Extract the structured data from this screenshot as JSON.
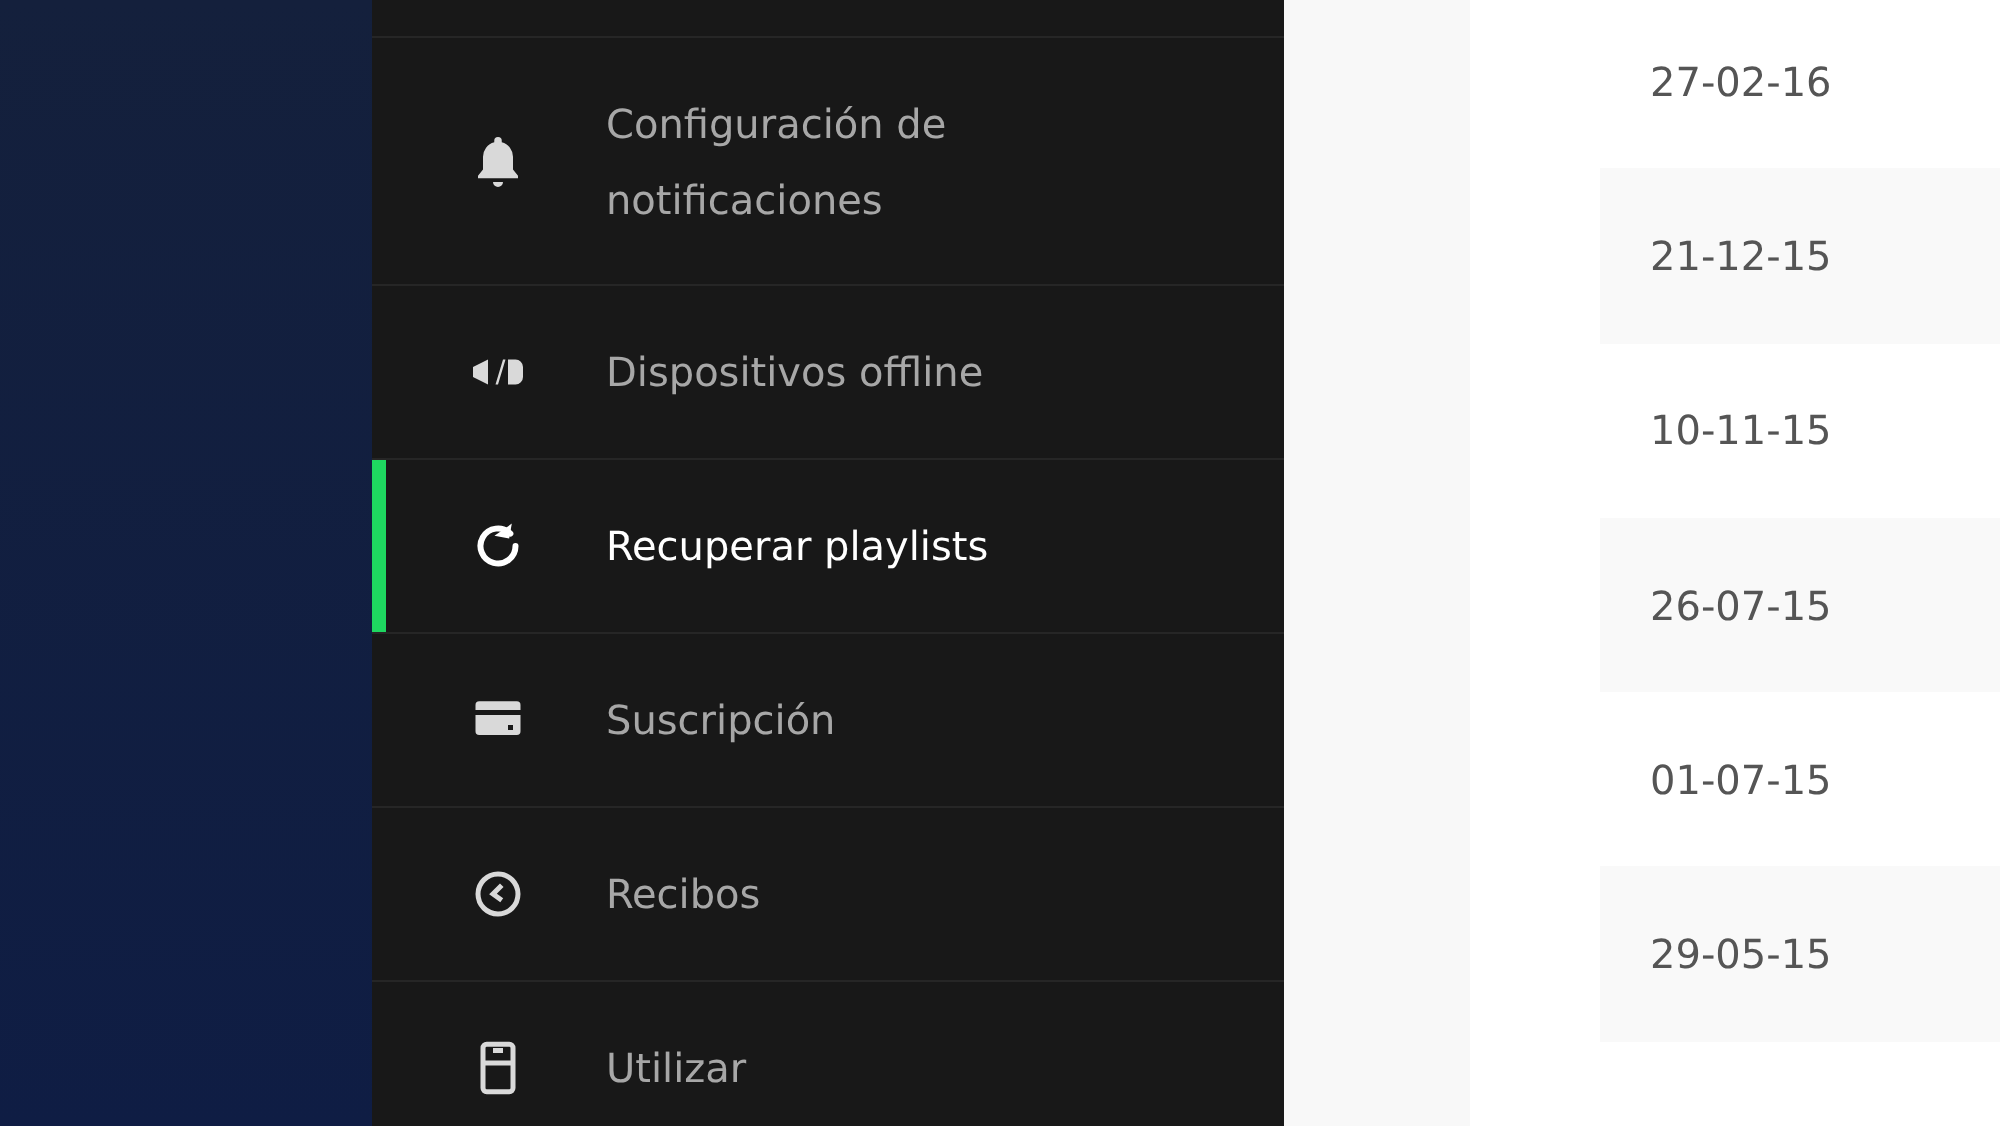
{
  "sidebar": {
    "items": [
      {
        "label": "Configuración de notificaciones",
        "selected": false
      },
      {
        "label": "Dispositivos offline",
        "selected": false
      },
      {
        "label": "Recuperar playlists",
        "selected": true
      },
      {
        "label": "Suscripción",
        "selected": false
      },
      {
        "label": "Recibos",
        "selected": false
      },
      {
        "label": "Utilizar",
        "selected": false
      }
    ]
  },
  "table": {
    "rows": [
      {
        "date": "27-02-16"
      },
      {
        "date": "21-12-15"
      },
      {
        "date": "10-11-15"
      },
      {
        "date": "26-07-15"
      },
      {
        "date": "01-07-15"
      },
      {
        "date": "29-05-15"
      }
    ]
  }
}
